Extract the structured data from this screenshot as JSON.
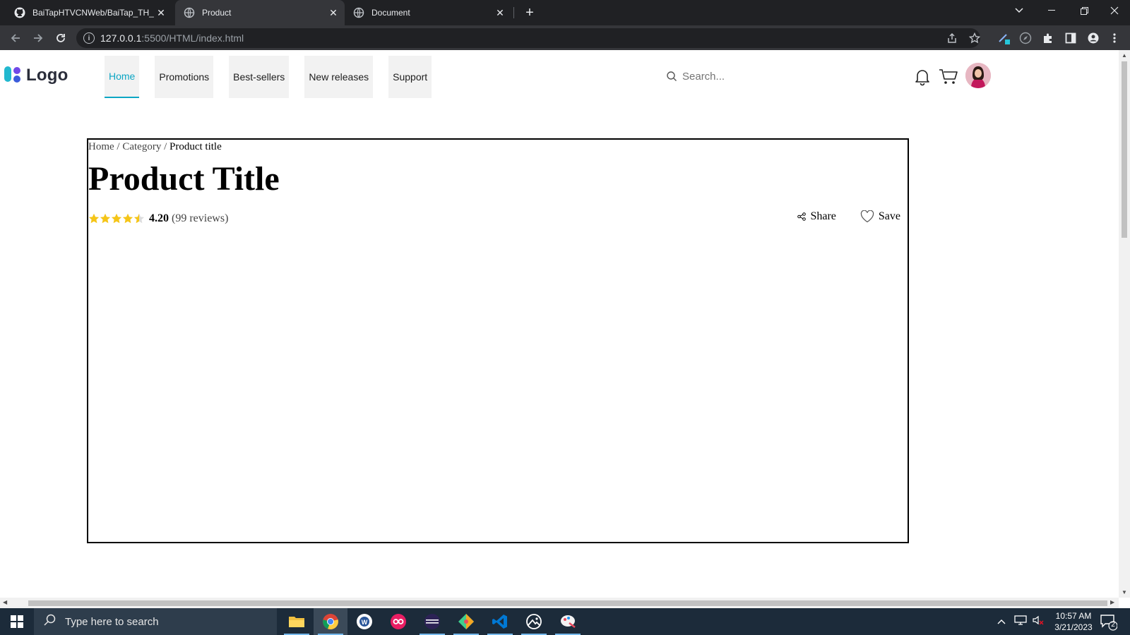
{
  "browser": {
    "tabs": [
      {
        "title": "BaiTapHTVCNWeb/BaiTap_TH_Tu",
        "active": false
      },
      {
        "title": "Product",
        "active": true
      },
      {
        "title": "Document",
        "active": false
      }
    ],
    "close_glyph": "✕",
    "new_tab_glyph": "+",
    "url_host": "127.0.0.1",
    "url_path": ":5500/HTML/index.html"
  },
  "site": {
    "logo_text": "Logo",
    "menu": [
      {
        "label": "Home",
        "active": true
      },
      {
        "label": "Promotions",
        "active": false
      },
      {
        "label": "Best-sellers",
        "active": false
      },
      {
        "label": "New releases",
        "active": false
      },
      {
        "label": "Support",
        "active": false
      }
    ],
    "search_placeholder": "Search...",
    "accent_color": "#0ca6c4"
  },
  "product": {
    "breadcrumb": {
      "home": "Home",
      "category": "Category",
      "current": "Product title",
      "separator": "/"
    },
    "title": "Product Title",
    "rating": {
      "value": "4.20",
      "stars_out_of_5": 4.5,
      "reviews": "(99 reviews)",
      "star_color": "#f5c518"
    },
    "share_label": "Share",
    "save_label": "Save"
  },
  "taskbar": {
    "search_placeholder": "Type here to search",
    "time": "10:57 AM",
    "date": "3/21/2023",
    "notification_count": "2"
  }
}
